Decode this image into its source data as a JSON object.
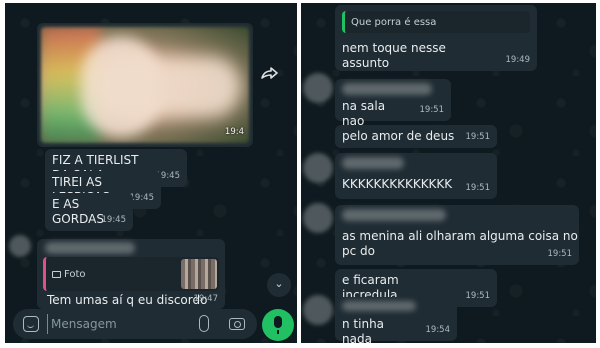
{
  "colors": {
    "chat_background": "#0e1a1f",
    "bubble": "#1f2c33",
    "text": "#e9edef",
    "timestamp": "#aeb9be",
    "accent_green": "#21c063",
    "reply_bar_pink": "#e04f88"
  },
  "left_chat": {
    "photo_message": {
      "time": "19:4"
    },
    "messages": [
      {
        "text": "FIZ A TIERLIST DA SALA",
        "time": "19:45"
      },
      {
        "text": "TIREI AS LESBICAS",
        "time": "19:45"
      },
      {
        "text": "E AS\nGORDAS",
        "time": "19:45"
      }
    ],
    "reply_message": {
      "quote_icon": "camera-icon",
      "quote_label": "Foto",
      "text": "Tem umas aí q eu discordo",
      "time": "19:47"
    },
    "forward_icon": "forward-icon",
    "scroll_button_icon": "chevrons-down-icon",
    "composer": {
      "placeholder": "Mensagem",
      "icons": [
        "sticker-icon",
        "paperclip-icon",
        "camera-icon",
        "microphone-icon"
      ]
    }
  },
  "right_chat": {
    "first_message": {
      "quote_text": "Que porra é essa",
      "text": "nem toque nesse assunto",
      "time": "19:49"
    },
    "messages": [
      {
        "text": "na sala nao",
        "time": "19:51"
      },
      {
        "text": "pelo amor de deus",
        "time": "19:51"
      },
      {
        "text": "KKKKKKKKKKKKKK",
        "time": "19:51"
      },
      {
        "text": "as menina ali olharam alguma coisa no pc do",
        "time": "19:51"
      },
      {
        "text": "e ficaram incredula",
        "time": "19:51"
      },
      {
        "text": "n tinha nada",
        "time": "19:54"
      }
    ]
  }
}
